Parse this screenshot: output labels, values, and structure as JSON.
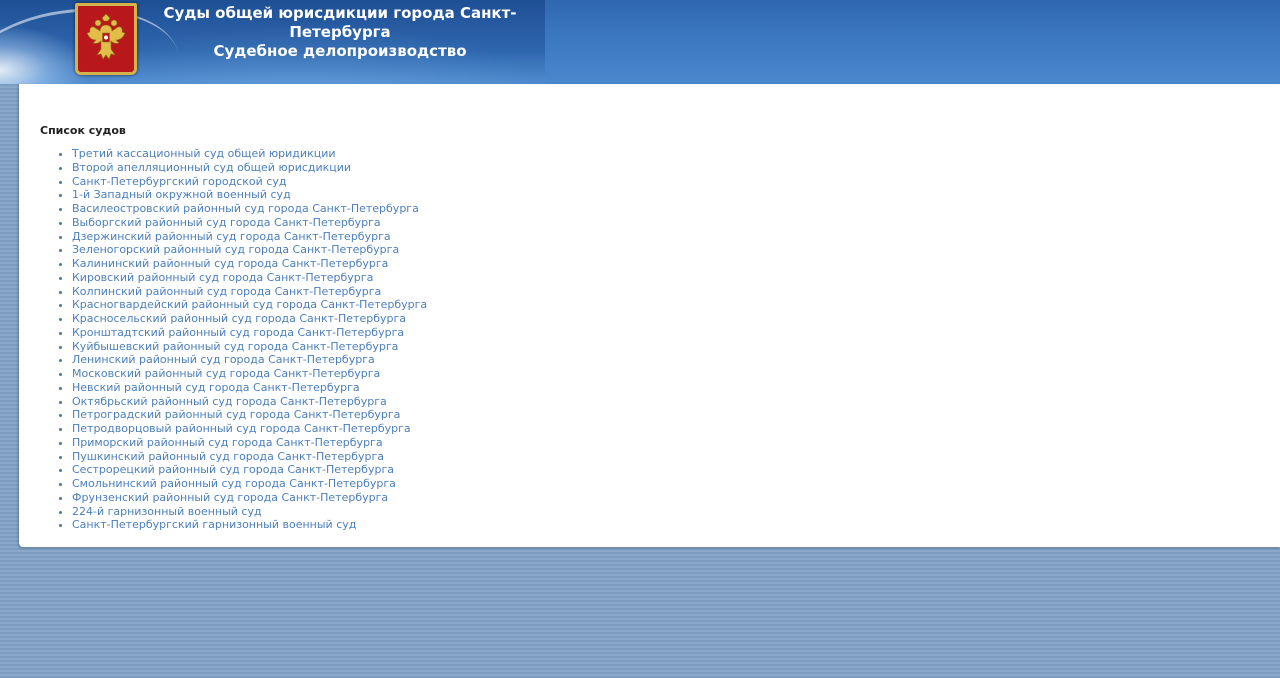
{
  "header": {
    "title_line1": "Суды общей юрисдикции города Санкт-Петербурга",
    "title_line2": "Судебное делопроизводство",
    "emblem_icon": "russian-coat-of-arms-icon"
  },
  "main": {
    "list_title": "Список судов",
    "courts": [
      "Третий кассационный суд общей юридикции",
      "Второй апелляционный суд общей юрисдикции",
      "Санкт-Петербургский городской суд",
      "1-й Западный окружной военный суд",
      "Василеостровский районный суд города Санкт-Петербурга",
      "Выборгский районный суд города Санкт-Петербурга",
      "Дзержинский районный суд города Санкт-Петербурга",
      "Зеленогорский районный суд города Санкт-Петербурга",
      "Калининский районный суд города Санкт-Петербурга",
      "Кировский районный суд города Санкт-Петербурга",
      "Колпинский районный суд города Санкт-Петербурга",
      "Красногвардейский районный суд города Санкт-Петербурга",
      "Красносельский районный суд города Санкт-Петербурга",
      "Кронштадтский районный суд города Санкт-Петербурга",
      "Куйбышевский районный суд города Санкт-Петербурга",
      "Ленинский районный суд города Санкт-Петербурга",
      "Московский районный суд города Санкт-Петербурга",
      "Невский районный суд города Санкт-Петербурга",
      "Октябрьский районный суд города Санкт-Петербурга",
      "Петроградский районный суд города Санкт-Петербурга",
      "Петродворцовый районный суд города Санкт-Петербурга",
      "Приморский районный суд города Санкт-Петербурга",
      "Пушкинский районный суд города Санкт-Петербурга",
      "Сестрорецкий районный суд города Санкт-Петербурга",
      "Смольнинский районный суд города Санкт-Петербурга",
      "Фрунзенский районный суд города Санкт-Петербурга",
      "224-й гарнизонный военный суд",
      "Санкт-Петербургский гарнизонный военный суд"
    ]
  },
  "colors": {
    "header_blue": "#3c78c1",
    "link": "#4c7fba",
    "background": "#8aa8c9"
  }
}
